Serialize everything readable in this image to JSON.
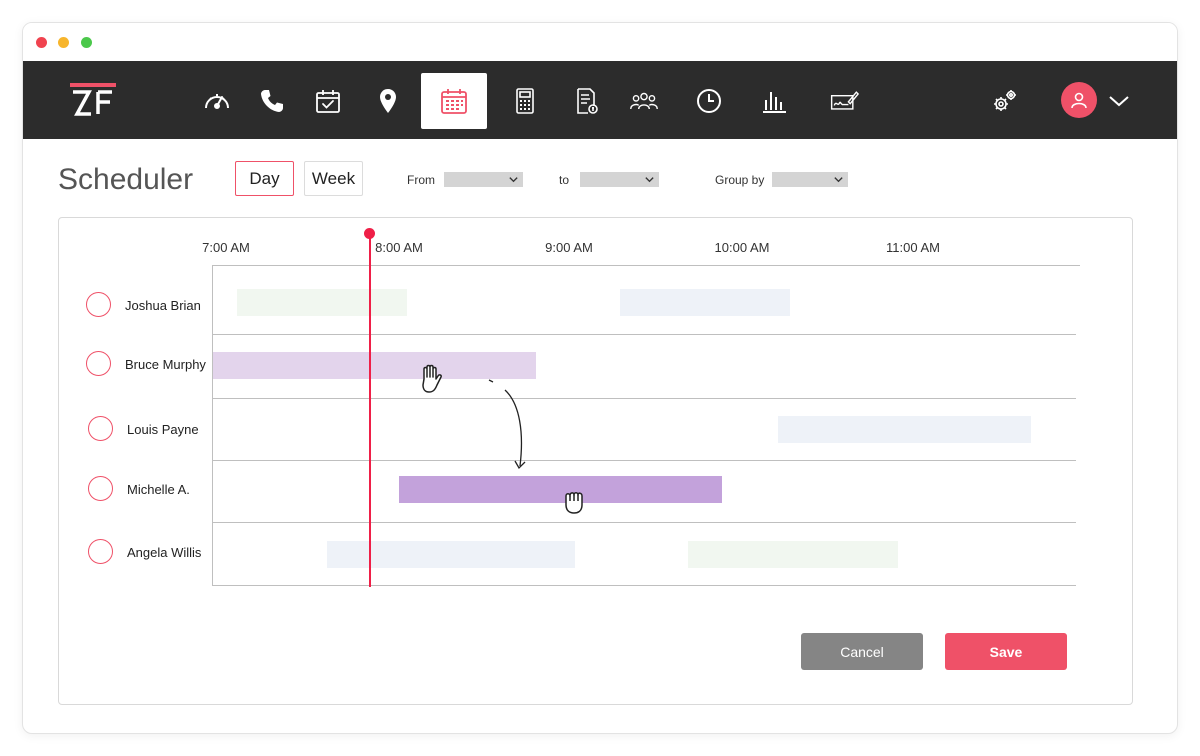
{
  "brand": {
    "logo_text": "ZF",
    "accent": "#ef5168",
    "nav_bg": "#2c2c2c",
    "now_color": "#ef1f47"
  },
  "nav": {
    "icons": [
      "speedometer-icon",
      "phone-icon",
      "calendar-check-icon",
      "location-pin-icon",
      "calendar-grid-icon",
      "calculator-icon",
      "invoice-icon",
      "team-icon",
      "clock-icon",
      "bar-chart-icon",
      "signature-icon",
      "settings-icon"
    ],
    "active": "calendar-grid-icon"
  },
  "header": {
    "title": "Scheduler",
    "view_day": "Day",
    "view_week": "Week",
    "active_view": "Day"
  },
  "filters": {
    "from_label": "From",
    "to_label": "to",
    "group_label": "Group by"
  },
  "timeline": {
    "times": [
      "7:00 AM",
      "8:00 AM",
      "9:00 AM",
      "10:00 AM",
      "11:00 AM"
    ],
    "current_time_marker_hours": 7.92
  },
  "rows": [
    {
      "name": "Joshua Brian"
    },
    {
      "name": "Bruce Murphy"
    },
    {
      "name": "Louis Payne"
    },
    {
      "name": "Michelle A."
    },
    {
      "name": "Angela Willis"
    }
  ],
  "events": [
    {
      "person": "Joshua Brian",
      "start": "7:00 AM",
      "end": "8:00 AM",
      "color": "#f1f7f0"
    },
    {
      "person": "Joshua Brian",
      "start": "9:15 AM",
      "end": "10:15 AM",
      "color": "#eef2f8"
    },
    {
      "person": "Bruce Murphy",
      "start": "7:00 AM",
      "end": "8:45 AM",
      "color": "#e3d4ec",
      "state": "ghost"
    },
    {
      "person": "Louis Payne",
      "start": "10:15 AM",
      "end": "11:45 AM",
      "color": "#eef2f8"
    },
    {
      "person": "Michelle A.",
      "start": "8:00 AM",
      "end": "9:55 AM",
      "color": "#c3a2db",
      "state": "dragging"
    },
    {
      "person": "Angela Willis",
      "start": "7:30 AM",
      "end": "9:00 AM",
      "color": "#eef2f8"
    },
    {
      "person": "Angela Willis",
      "start": "10:00 AM",
      "end": "11:15 AM",
      "color": "#f1f7f0"
    }
  ],
  "actions": {
    "cancel": "Cancel",
    "save": "Save"
  }
}
